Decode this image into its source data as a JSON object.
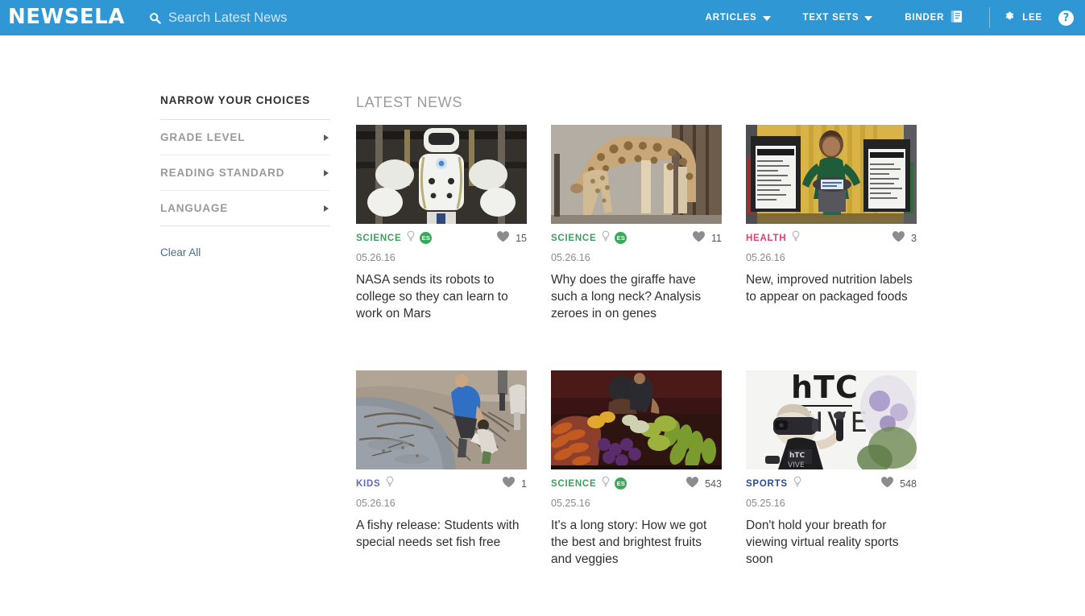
{
  "header": {
    "brand": "NEWSELA",
    "search": {
      "placeholder": "Search Latest News",
      "value": "",
      "icon": "search-icon"
    },
    "nav": [
      {
        "label": "ARTICLES",
        "icon": "chevron-down-icon"
      },
      {
        "label": "TEXT SETS",
        "icon": "chevron-down-icon"
      },
      {
        "label": "BINDER",
        "icon": "binder-book-icon"
      }
    ],
    "user": {
      "label": "LEE",
      "icon": "gear-icon"
    },
    "help": {
      "label": "?",
      "icon": "help-icon"
    },
    "accent_color": "#2e97d4"
  },
  "sidebar": {
    "title": "NARROW YOUR CHOICES",
    "filters": [
      {
        "label": "GRADE LEVEL",
        "icon": "chevron-right-icon"
      },
      {
        "label": "READING STANDARD",
        "icon": "chevron-right-icon"
      },
      {
        "label": "LANGUAGE",
        "icon": "chevron-right-icon"
      }
    ],
    "clear_all": "Clear All"
  },
  "main": {
    "section_title": "LATEST NEWS",
    "articles": [
      {
        "category": "SCIENCE",
        "category_color": "#3f9e5e",
        "has_bulb": true,
        "has_es_badge": true,
        "es_label": "ES",
        "likes": "15",
        "date": "05.26.16",
        "headline": "NASA sends its robots to college so they can learn to work on Mars",
        "image": "nasa-valkyrie-robot"
      },
      {
        "category": "SCIENCE",
        "category_color": "#3f9e5e",
        "has_bulb": true,
        "has_es_badge": true,
        "es_label": "ES",
        "likes": "11",
        "date": "05.26.16",
        "headline": "Why does the giraffe have such a long neck? Analysis zeroes in on genes",
        "image": "giraffe-and-calf"
      },
      {
        "category": "HEALTH",
        "category_color": "#d8436f",
        "has_bulb": true,
        "has_es_badge": false,
        "es_label": "",
        "likes": "3",
        "date": "05.26.16",
        "headline": "New, improved nutrition labels to appear on packaged foods",
        "image": "nutrition-label-announcement"
      },
      {
        "category": "KIDS",
        "category_color": "#5b6bb5",
        "has_bulb": true,
        "has_es_badge": false,
        "es_label": "",
        "likes": "1",
        "date": "05.26.16",
        "headline": "A fishy release: Students with special needs set fish free",
        "image": "students-releasing-fish-in-stream"
      },
      {
        "category": "SCIENCE",
        "category_color": "#3f9e5e",
        "has_bulb": true,
        "has_es_badge": true,
        "es_label": "ES",
        "likes": "543",
        "date": "05.25.16",
        "headline": "It's a long story: How we got the best and brightest fruits and veggies",
        "image": "vegetable-market-stall"
      },
      {
        "category": "SPORTS",
        "category_color": "#2b4d8e",
        "has_bulb": true,
        "has_es_badge": false,
        "es_label": "",
        "likes": "548",
        "date": "05.25.16",
        "headline": "Don't hold your breath for viewing virtual reality sports soon",
        "image": "htc-vive-vr-headset-demo"
      }
    ]
  }
}
